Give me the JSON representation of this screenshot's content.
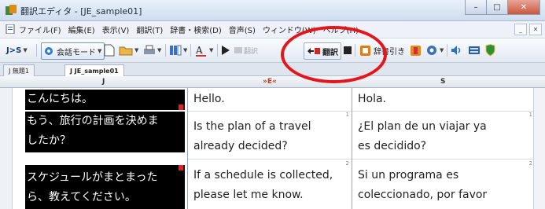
{
  "window": {
    "title": "翻訳エディタ - [JE_sample01]",
    "controls": [
      "–",
      "□",
      "✕"
    ]
  },
  "menu": {
    "items": [
      "ファイル(F)",
      "編集(E)",
      "表示(V)",
      "翻訳(T)",
      "辞書・検索(D)",
      "音声(S)",
      "ウィンドウ(W)",
      "ヘルプ(H)"
    ],
    "mdi": [
      "_",
      "✕"
    ]
  },
  "toolbar": {
    "lang_pair": "J>S",
    "mode_label": "会話モード",
    "translate_label": "翻訳",
    "dict_label": "辞書引き",
    "disabled_label": "翻訳",
    "colors": {
      "translate": "#cc2a2a",
      "play": "#222222",
      "dict": "#e07a14"
    }
  },
  "tabs": [
    {
      "label": "J  無題1",
      "active": false
    },
    {
      "label": "J  JE_sample01",
      "active": true
    }
  ],
  "columns": {
    "j": "J",
    "e": "»E«",
    "s": "S"
  },
  "rows": [
    {
      "j": [
        "こんにちは。"
      ],
      "e": [
        "Hello."
      ],
      "s": [
        "Hola."
      ],
      "num": "1"
    },
    {
      "j": [
        "もう、旅行の計画を決めま",
        "したか？"
      ],
      "e": [
        "Is the plan of a travel",
        "already decided?"
      ],
      "s": [
        "¿El plan de un viajar ya",
        "es decidido?"
      ],
      "num": "1"
    },
    {
      "j": [
        "スケジュールがまとまった",
        "ら、教えてください。"
      ],
      "e": [
        "If a schedule is collected,",
        "please let me know."
      ],
      "s": [
        "Si un programa es",
        "coleccionado, por favor"
      ],
      "num": "2"
    }
  ],
  "annotation": {
    "color": "#e3161c"
  }
}
